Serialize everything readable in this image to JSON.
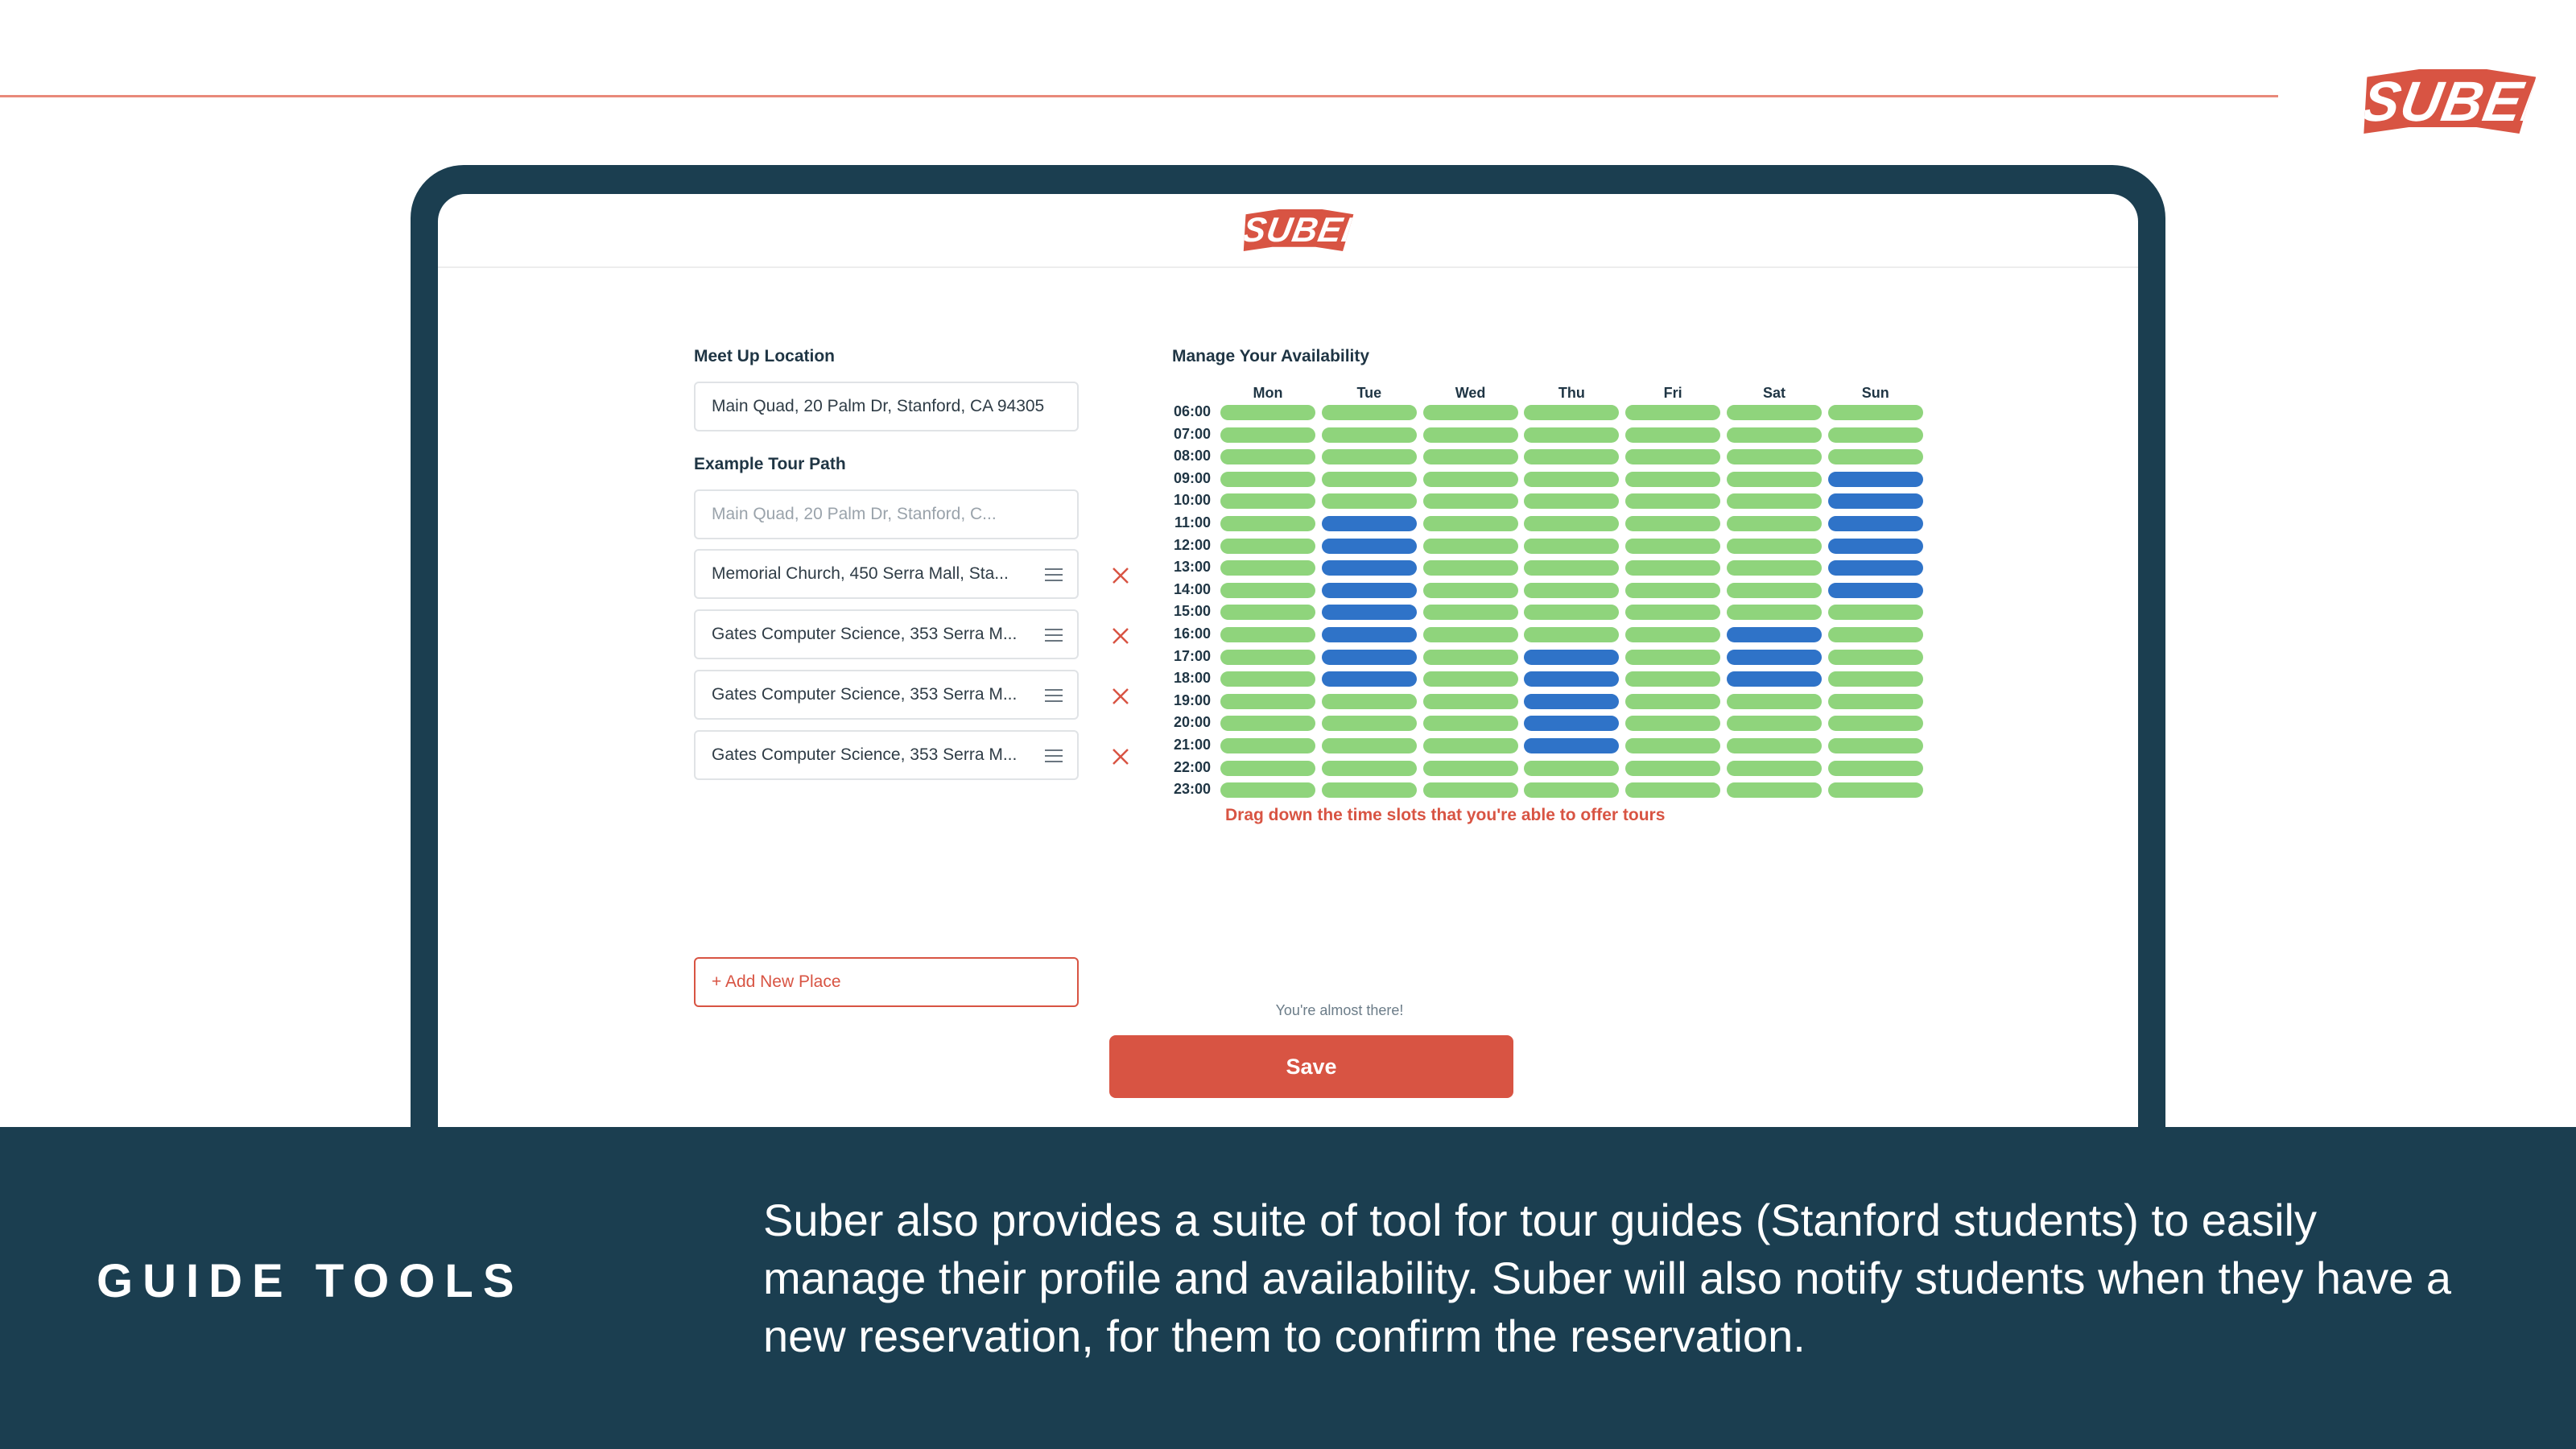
{
  "brand": {
    "logo_text": "SUBER",
    "accent": "#d85443",
    "navy": "#1b3e50"
  },
  "form": {
    "meetup_label": "Meet Up Location",
    "meetup_value": "Main Quad, 20 Palm Dr, Stanford, CA 94305",
    "tour_path_label": "Example Tour Path",
    "tour_start_placeholder": "Main Quad, 20 Palm Dr, Stanford, C...",
    "stops": [
      "Memorial Church, 450 Serra Mall, Sta...",
      "Gates Computer Science, 353 Serra M...",
      "Gates Computer Science, 353 Serra M...",
      "Gates Computer Science, 353 Serra M..."
    ],
    "add_place_label": "+ Add New Place",
    "stop_drag_icon": "drag-handle-icon",
    "stop_remove_icon": "close-icon"
  },
  "availability": {
    "label": "Manage Your Availability",
    "days": [
      "Mon",
      "Tue",
      "Wed",
      "Thu",
      "Fri",
      "Sat",
      "Sun"
    ],
    "times": [
      "06:00",
      "07:00",
      "08:00",
      "09:00",
      "10:00",
      "11:00",
      "12:00",
      "13:00",
      "14:00",
      "15:00",
      "16:00",
      "17:00",
      "18:00",
      "19:00",
      "20:00",
      "21:00",
      "22:00",
      "23:00"
    ],
    "selected": {
      "Tue": [
        "11:00",
        "12:00",
        "13:00",
        "14:00",
        "15:00",
        "16:00",
        "17:00",
        "18:00"
      ],
      "Thu": [
        "17:00",
        "18:00",
        "19:00",
        "20:00",
        "21:00"
      ],
      "Sat": [
        "16:00",
        "17:00",
        "18:00"
      ],
      "Sun": [
        "09:00",
        "10:00",
        "11:00",
        "12:00",
        "13:00",
        "14:00"
      ]
    },
    "colors": {
      "available": "#8fd47c",
      "selected": "#2f73c8"
    },
    "hint": "Drag down the time slots that you're able to offer tours"
  },
  "footer_cta": {
    "almost": "You're almost there!",
    "save_label": "Save"
  },
  "slide": {
    "section_title": "GUIDE TOOLS",
    "description": "Suber also provides a suite of tool for tour guides (Stanford students) to easily manage their profile and availability. Suber will also notify students when they have a new reservation, for them to confirm the reservation."
  }
}
